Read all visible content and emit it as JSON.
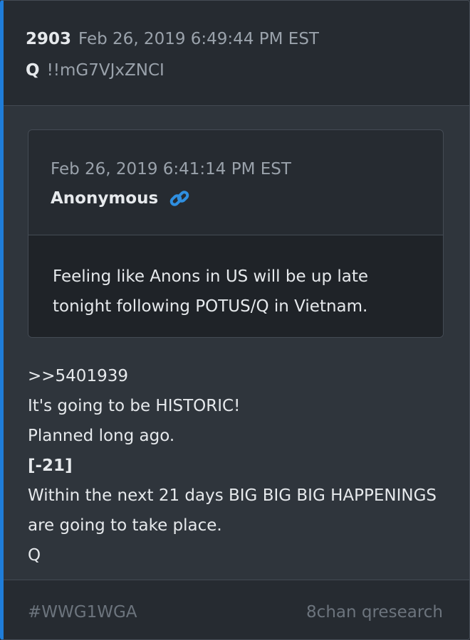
{
  "post": {
    "number": "2903",
    "timestamp": "Feb 26, 2019 6:49:44 PM EST",
    "author": "Q",
    "tripcode": "!!mG7VJxZNCI"
  },
  "quoted_post": {
    "timestamp": "Feb 26, 2019 6:41:14 PM EST",
    "author": "Anonymous",
    "link_icon": "link-icon",
    "text": "Feeling like Anons in US will be up late tonight following POTUS/Q in Vietnam."
  },
  "body": {
    "lines": [
      ">>5401939",
      "It's going to be HISTORIC!",
      "Planned long ago.",
      "[-21]",
      "Within the next 21 days BIG BIG BIG HAPPENINGS are going to take place.",
      "Q"
    ]
  },
  "footer": {
    "hashtag": "#WWG1WGA",
    "board": "8chan qresearch"
  },
  "colors": {
    "accent": "#1f7dd9",
    "link": "#2f8fe0"
  }
}
